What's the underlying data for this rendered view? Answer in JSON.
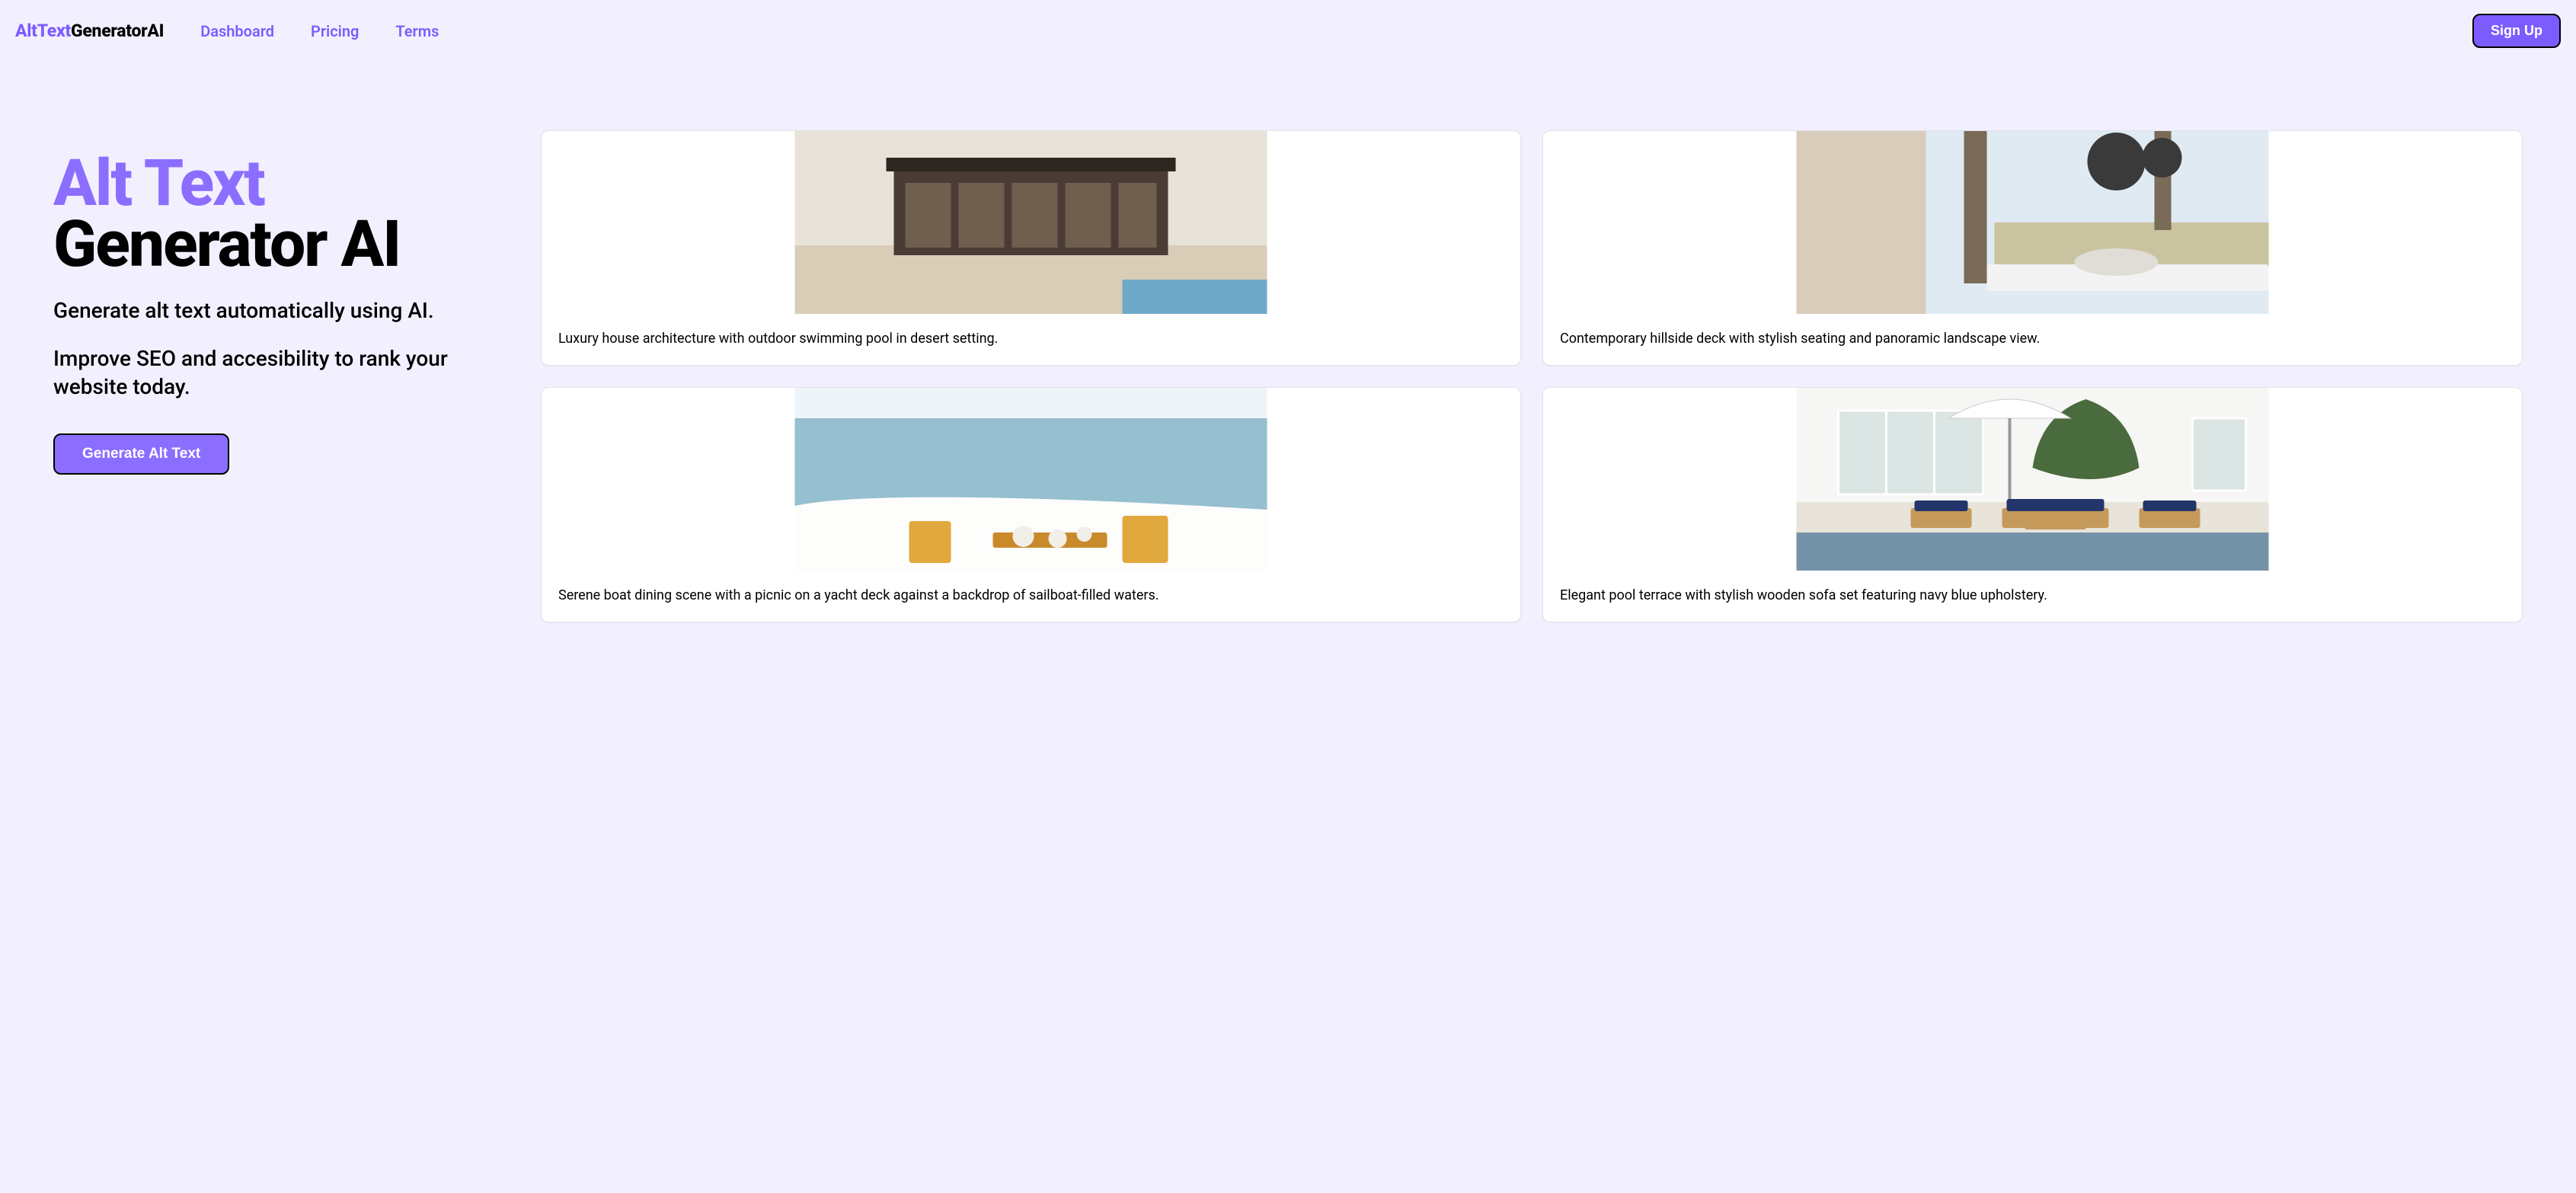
{
  "brand": {
    "part1": "AltText",
    "part2": "GeneratorAI"
  },
  "nav": {
    "links": [
      "Dashboard",
      "Pricing",
      "Terms"
    ],
    "signup": "Sign Up"
  },
  "hero": {
    "title_line1": "Alt Text",
    "title_line2": "Generator AI",
    "sub1": "Generate alt text automatically using AI.",
    "sub2": "Improve SEO and accesibility to rank your website today.",
    "cta": "Generate Alt Text"
  },
  "cards": [
    {
      "caption": "Luxury house architecture with outdoor swimming pool in desert setting."
    },
    {
      "caption": "Contemporary hillside deck with stylish seating and panoramic landscape view."
    },
    {
      "caption": "Serene boat dining scene with a picnic on a yacht deck against a backdrop of sailboat-filled waters."
    },
    {
      "caption": "Elegant pool terrace with stylish wooden sofa set featuring navy blue upholstery."
    }
  ]
}
